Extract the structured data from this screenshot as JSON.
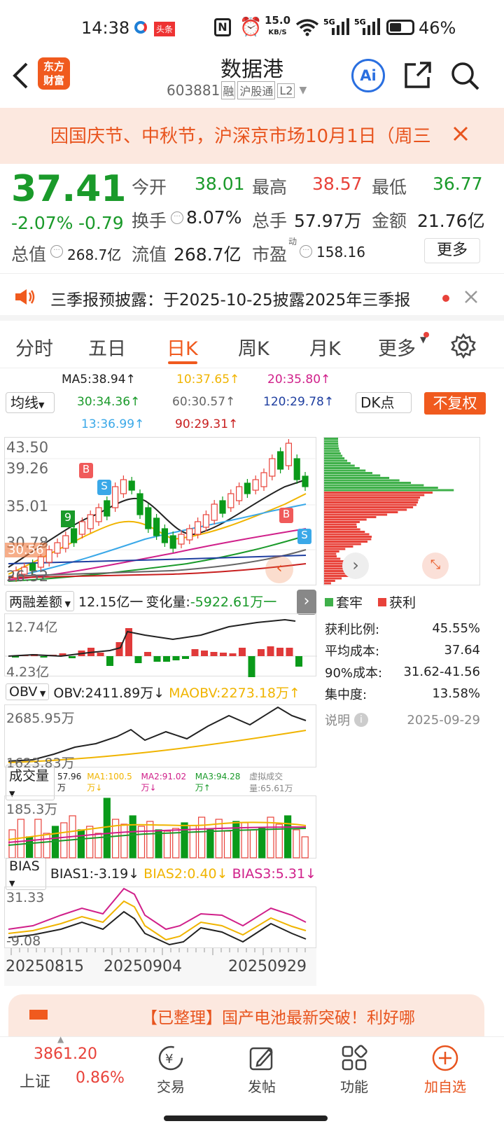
{
  "status_bar": {
    "time": "14:38",
    "toutiao": "头条",
    "speed_top": "15.0",
    "speed_unit": "KB/S",
    "battery": "46%"
  },
  "header": {
    "logo_line1": "东方",
    "logo_line2": "财富",
    "title": "数据港",
    "code": "603881",
    "tag_rong": "融",
    "tag_hgt": "沪股通",
    "tag_l2": "L2",
    "ai_label": "Ai"
  },
  "notice": {
    "text": "因国庆节、中秋节，沪深京市场10月1日（周三"
  },
  "quote": {
    "price": "37.41",
    "pct": "-2.07%",
    "change": "-0.79",
    "open_label": "今开",
    "open": "38.01",
    "high_label": "最高",
    "high": "38.57",
    "low_label": "最低",
    "low": "36.77",
    "turnover_label": "换手",
    "turnover": "8.07%",
    "volume_label": "总手",
    "volume": "57.97万",
    "amount_label": "金额",
    "amount": "21.76亿",
    "mktcap_label": "总值",
    "mktcap": "268.7亿",
    "float_label": "流值",
    "float": "268.7亿",
    "pe_label": "市盈",
    "pe_sup": "动",
    "pe": "158.16",
    "more": "更多"
  },
  "announce": {
    "text": "三季报预披露：于2025-10-25披露2025年三季报"
  },
  "tabs": [
    "分时",
    "五日",
    "日K",
    "周K",
    "月K",
    "更多"
  ],
  "ma": {
    "selector": "均线",
    "ma5": "MA5:38.94↑",
    "ma10": "10:37.65↑",
    "ma20": "20:35.80↑",
    "ma30": "30:34.36↑",
    "ma60": "60:30.57↑",
    "ma120": "120:29.78↑",
    "ma13": "13:36.99↑",
    "ma90": "90:29.31↑",
    "dk": "DK点",
    "fq": "不复权",
    "colors": {
      "ma5": "#222222",
      "ma10": "#f0b400",
      "ma20": "#d0208a",
      "ma30": "#1a9a2a",
      "ma60": "#666666",
      "ma120": "#1f3fa0",
      "ma13": "#3aa8e8",
      "ma90": "#c81e1e"
    }
  },
  "kchart": {
    "y_labels": [
      "43.50",
      "39.26",
      "35.01",
      "30.78",
      "26.52"
    ],
    "left_tag": "30.56",
    "tags": [
      "B",
      "S",
      "B",
      "S"
    ]
  },
  "chips": {
    "legend_trapped": "套牢",
    "legend_profit": "获利",
    "rows": [
      {
        "label": "获利比例:",
        "value": "45.55%"
      },
      {
        "label": "平均成本:",
        "value": "37.64"
      },
      {
        "label": "90%成本:",
        "value": "31.62-41.56"
      },
      {
        "label": "集中度:",
        "value": "13.58%"
      }
    ],
    "note_label": "说明",
    "date": "2025-09-29"
  },
  "margin": {
    "selector": "两融差额",
    "value": "12.15亿",
    "change_label": "变化量:",
    "change": "-5922.61万",
    "top": "12.74亿",
    "bottom": "4.23亿"
  },
  "obv": {
    "selector": "OBV",
    "obv": "OBV:2411.89万↓",
    "maobv": "MAOBV:2273.18万↑",
    "top": "2685.95万",
    "bottom": "1623.83万"
  },
  "vol": {
    "selector": "成交量",
    "v": "57.96万",
    "ma1": "MA1:100.5万↓",
    "ma2": "MA2:91.02万↓",
    "ma3": "MA3:94.28万↑",
    "virtual": "虚拟成交量:65.61万",
    "top": "185.3万"
  },
  "bias": {
    "selector": "BIAS",
    "b1": "BIAS1:-3.19↓",
    "b2": "BIAS2:0.40↓",
    "b3": "BIAS3:5.31↓",
    "top": "31.33",
    "bottom": "-9.08"
  },
  "dates": [
    "20250815",
    "20250904",
    "20250929"
  ],
  "banner": {
    "text": "【已整理】国产电池最新突破！利好哪"
  },
  "bottom": {
    "index_value": "3861.20",
    "index_name": "上证",
    "index_pct": "0.86%",
    "trade": "交易",
    "post": "发帖",
    "func": "功能",
    "add": "加自选"
  }
}
